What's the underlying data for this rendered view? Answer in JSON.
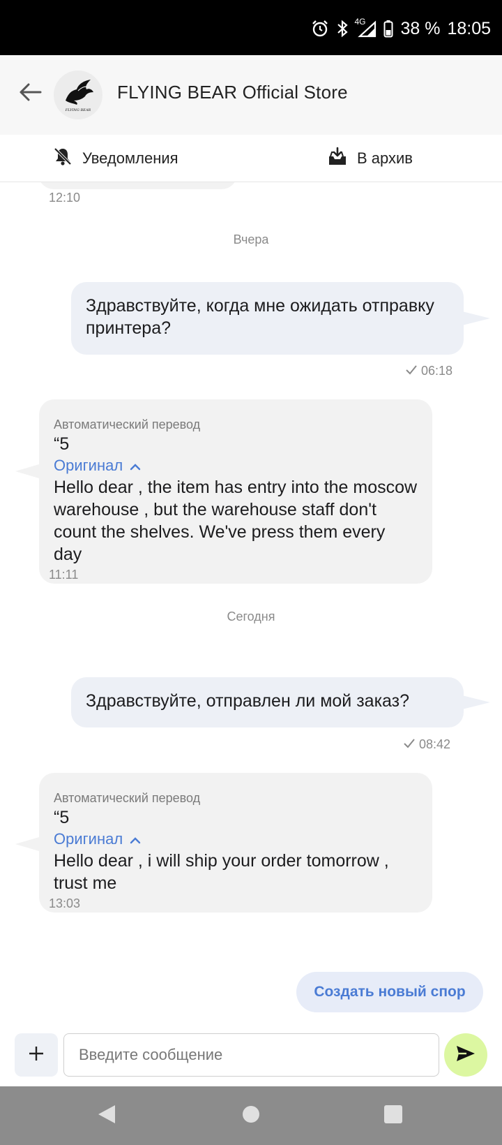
{
  "status_bar": {
    "network": "4G",
    "battery": "38 %",
    "time": "18:05"
  },
  "header": {
    "store_name": "FLYING BEAR Official Store",
    "logo_caption": "FLYING BEAR"
  },
  "actions": {
    "notifications_label": "Уведомления",
    "archive_label": "В архив"
  },
  "chat": {
    "prev_time": "12:10",
    "messages": [
      {
        "date_separator": "Вчера",
        "outgoing_text": "Здравствуйте, когда мне ожидать отправку принтера?",
        "outgoing_time": "06:18",
        "incoming": {
          "auto_label": "Автоматический перевод",
          "translated": "“5",
          "original_label": "Оригинал",
          "text": "Hello dear , the item has entry into the moscow warehouse , but the warehouse staff don't count the shelves. We've press them every day",
          "time": "11:11"
        }
      },
      {
        "date_separator": "Сегодня",
        "outgoing_text": "Здравствуйте, отправлен ли мой заказ?",
        "outgoing_time": "08:42",
        "incoming": {
          "auto_label": "Автоматический перевод",
          "translated": "“5",
          "original_label": "Оригинал",
          "text": "Hello dear , i will ship your order tomorrow , trust me",
          "time": "13:03"
        }
      }
    ],
    "dispute_button": "Создать новый спор"
  },
  "composer": {
    "placeholder": "Введите сообщение",
    "value": ""
  },
  "colors": {
    "accent_link": "#4a7bd4",
    "send_button": "#dcf7a1",
    "outgoing_bubble": "#edf0f6",
    "incoming_bubble": "#f2f2f2"
  },
  "icons": [
    "alarm-icon",
    "bluetooth-icon",
    "signal-icon",
    "battery-icon",
    "back-arrow-icon",
    "bell-off-icon",
    "archive-icon",
    "check-icon",
    "chevron-up-icon",
    "plus-icon",
    "send-icon",
    "nav-back-icon",
    "nav-home-icon",
    "nav-recents-icon"
  ]
}
